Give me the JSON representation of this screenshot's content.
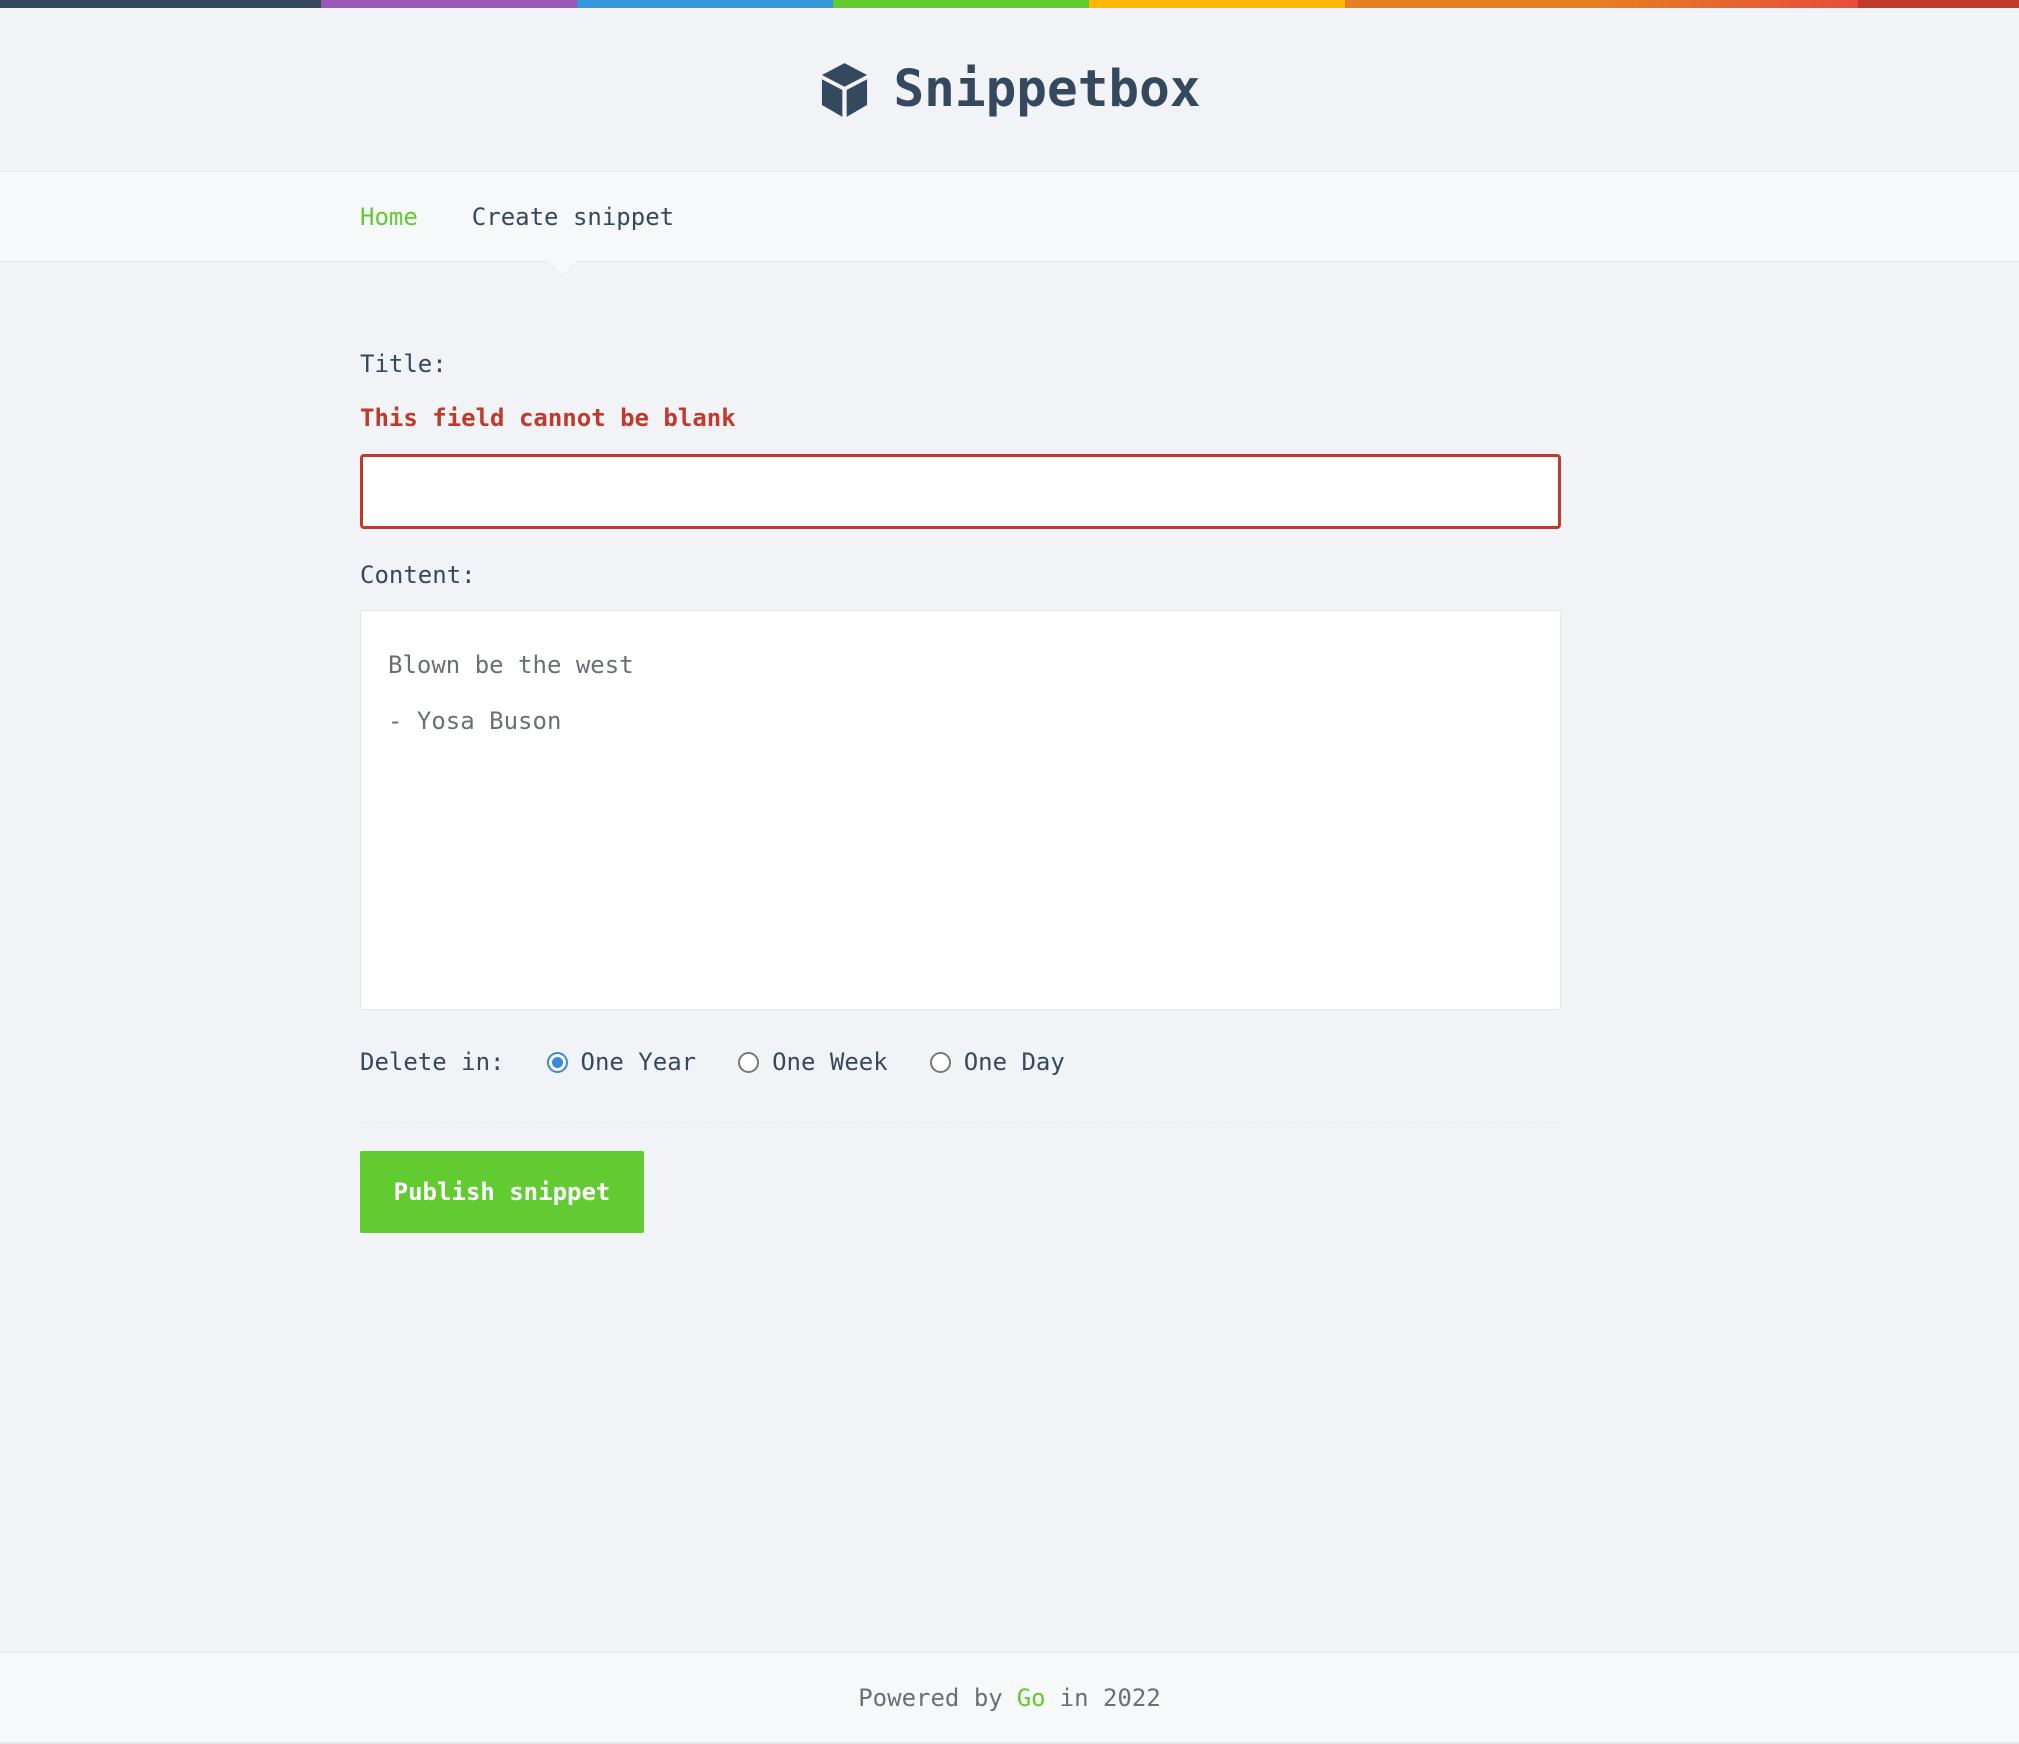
{
  "rainbow_colors": [
    "#34495e",
    "#9b59b6",
    "#3498db",
    "#62cb31",
    "#ffb606",
    "#e67e22",
    "#e74c3c",
    "#c0392b"
  ],
  "brand": {
    "name": "Snippetbox",
    "icon": "cube-icon"
  },
  "nav": {
    "home": "Home",
    "create": "Create snippet"
  },
  "form": {
    "title_label": "Title:",
    "title_error": "This field cannot be blank",
    "title_value": "",
    "content_label": "Content:",
    "content_value": "Blown be the west\n- Yosa Buson",
    "delete_label": "Delete in:",
    "expires_options": [
      {
        "label": "One Year",
        "checked": true
      },
      {
        "label": "One Week",
        "checked": false
      },
      {
        "label": "One Day",
        "checked": false
      }
    ],
    "submit_label": "Publish snippet"
  },
  "footer": {
    "prefix": "Powered by",
    "link": "Go",
    "suffix": "in 2022"
  },
  "colors": {
    "accent": "#62cb31",
    "error": "#c0392b",
    "text": "#34495e",
    "radio_selected": "#3a86d9"
  }
}
